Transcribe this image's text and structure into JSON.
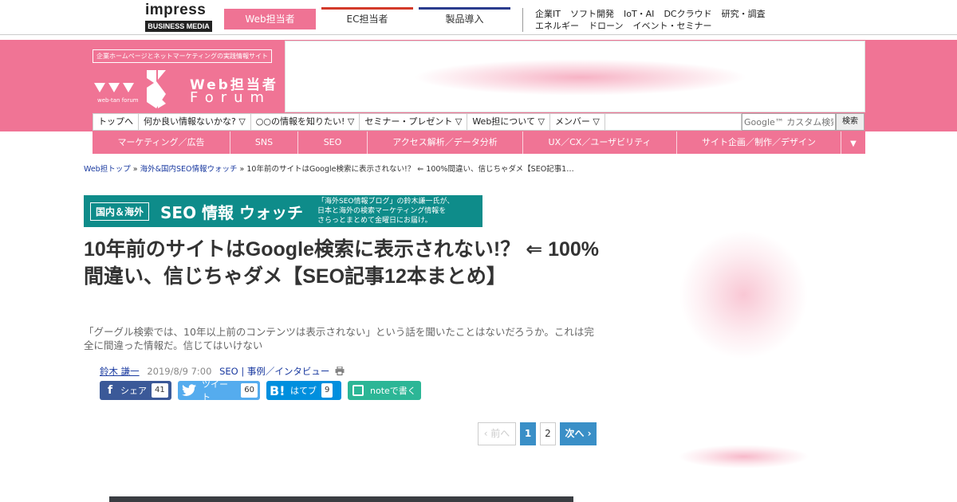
{
  "topbar": {
    "impress_word": "impress",
    "impress_sub": "BUSINESS MEDIA",
    "tabs": [
      {
        "label": "Web担当者"
      },
      {
        "label": "EC担当者"
      },
      {
        "label": "製品導入"
      }
    ],
    "links_row1": [
      "企業IT",
      "ソフト開発",
      "IoT・AI",
      "DCクラウド",
      "研究・調査"
    ],
    "links_row2": [
      "エネルギー",
      "ドローン",
      "イベント・セミナー"
    ]
  },
  "header": {
    "tagline": "企業ホームページとネットマーケティングの実践情報サイト",
    "logo_title": "Web担当者",
    "logo_sub": "Forum",
    "logo_small": "web-tan forum"
  },
  "menu": {
    "items": [
      "トップへ",
      "何か良い情報ないかな? ▽",
      "○○の情報を知りたい! ▽",
      "セミナー・プレゼント ▽",
      "Web担について ▽",
      "メンバー ▽"
    ],
    "search_placeholder": "Google™ カスタム検索",
    "search_button": "検索"
  },
  "categories": [
    "マーケティング／広告",
    "SNS",
    "SEO",
    "アクセス解析／データ分析",
    "UX／CX／ユーザビリティ",
    "サイト企画／制作／デザイン"
  ],
  "category_more": "▼",
  "breadcrumb": {
    "home": "Web担トップ",
    "sep": "»",
    "section": "海外&国内SEO情報ウォッチ",
    "current": "10年前のサイトはGoogle検索に表示されない!？ ⇐ 100%間違い、信じちゃダメ【SEO記事1…"
  },
  "seo_banner": {
    "badge": "国内＆海外",
    "title": "SEO 情報 ウォッチ",
    "desc_line1": "「海外SEO情報ブログ」の鈴木謙一氏が、",
    "desc_line2": "日本と海外の検索マーケティング情報を",
    "desc_line3": "さらっとまとめて金曜日にお届け。"
  },
  "article": {
    "title": "10年前のサイトはGoogle検索に表示されない!？ ⇐ 100%間違い、信じちゃダメ【SEO記事12本まとめ】",
    "lead": "「グーグル検索では、10年以上前のコンテンツは表示されない」という話を聞いたことはないだろうか。これは完全に間違った情報だ。信じてはいけない",
    "author": "鈴木 謙一",
    "date": "2019/8/9 7:00",
    "category1": "SEO",
    "category_sep": "|",
    "category2": "事例／インタビュー"
  },
  "share": {
    "facebook_label": "シェア",
    "facebook_count": "41",
    "twitter_label": "ツイート",
    "twitter_count": "60",
    "hatena_label": "はてブ",
    "hatena_count": "9",
    "note_label": "noteで書く"
  },
  "pager": {
    "prev": "‹ 前へ",
    "page1": "1",
    "page2": "2",
    "next": "次へ ›"
  },
  "colors": {
    "brand_pink": "#f07495",
    "link_blue": "#1a3aa0",
    "pager_blue": "#3a8fc7"
  }
}
